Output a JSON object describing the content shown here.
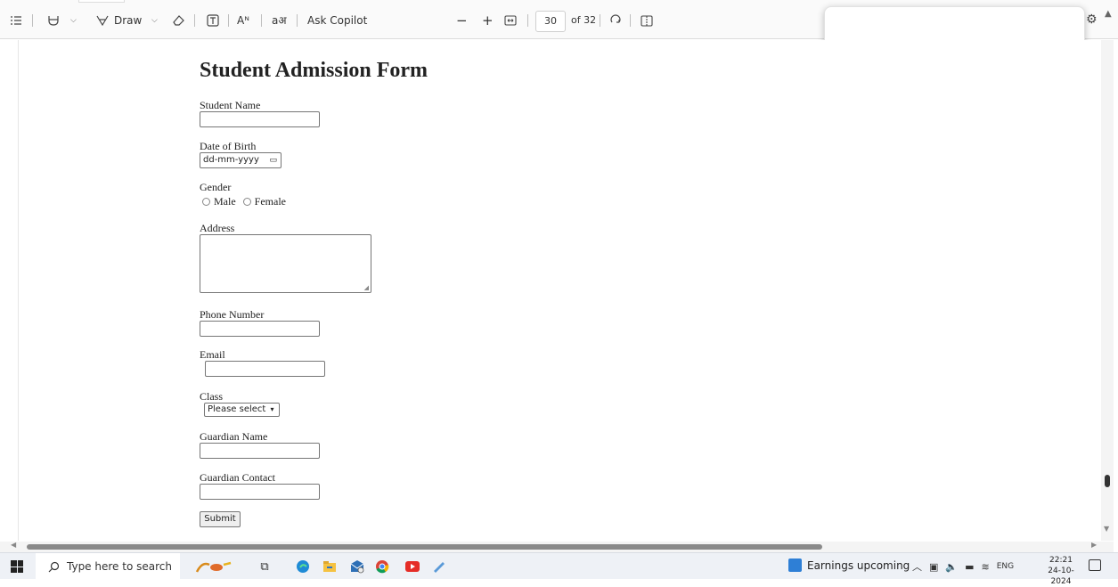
{
  "toolbar": {
    "draw_label": "Draw",
    "read_aloud_label": "Aᴺ",
    "translate_label": "aअ",
    "copilot_label": "Ask Copilot",
    "zoom_out": "−",
    "zoom_in": "+",
    "page_current": "30",
    "page_total": "of 32"
  },
  "form": {
    "title": "Student Admission Form",
    "student_name_label": "Student Name",
    "dob_label": "Date of Birth",
    "dob_placeholder": "dd-mm-yyyy",
    "gender_label": "Gender",
    "gender_options": [
      "Male",
      "Female"
    ],
    "address_label": "Address",
    "phone_label": "Phone Number",
    "email_label": "Email",
    "class_label": "Class",
    "class_selected": "Please select",
    "guardian_name_label": "Guardian Name",
    "guardian_contact_label": "Guardian Contact",
    "submit_label": "Submit"
  },
  "taskbar": {
    "search_placeholder": "Type here to search",
    "news_label": "Earnings upcoming",
    "language": "ENG",
    "time": "22:21",
    "date": "24-10-2024"
  },
  "colors": {
    "toolbar_bg": "#fafafa",
    "taskbar_bg": "#eef1f6",
    "accent_blue": "#2e7fd6"
  }
}
